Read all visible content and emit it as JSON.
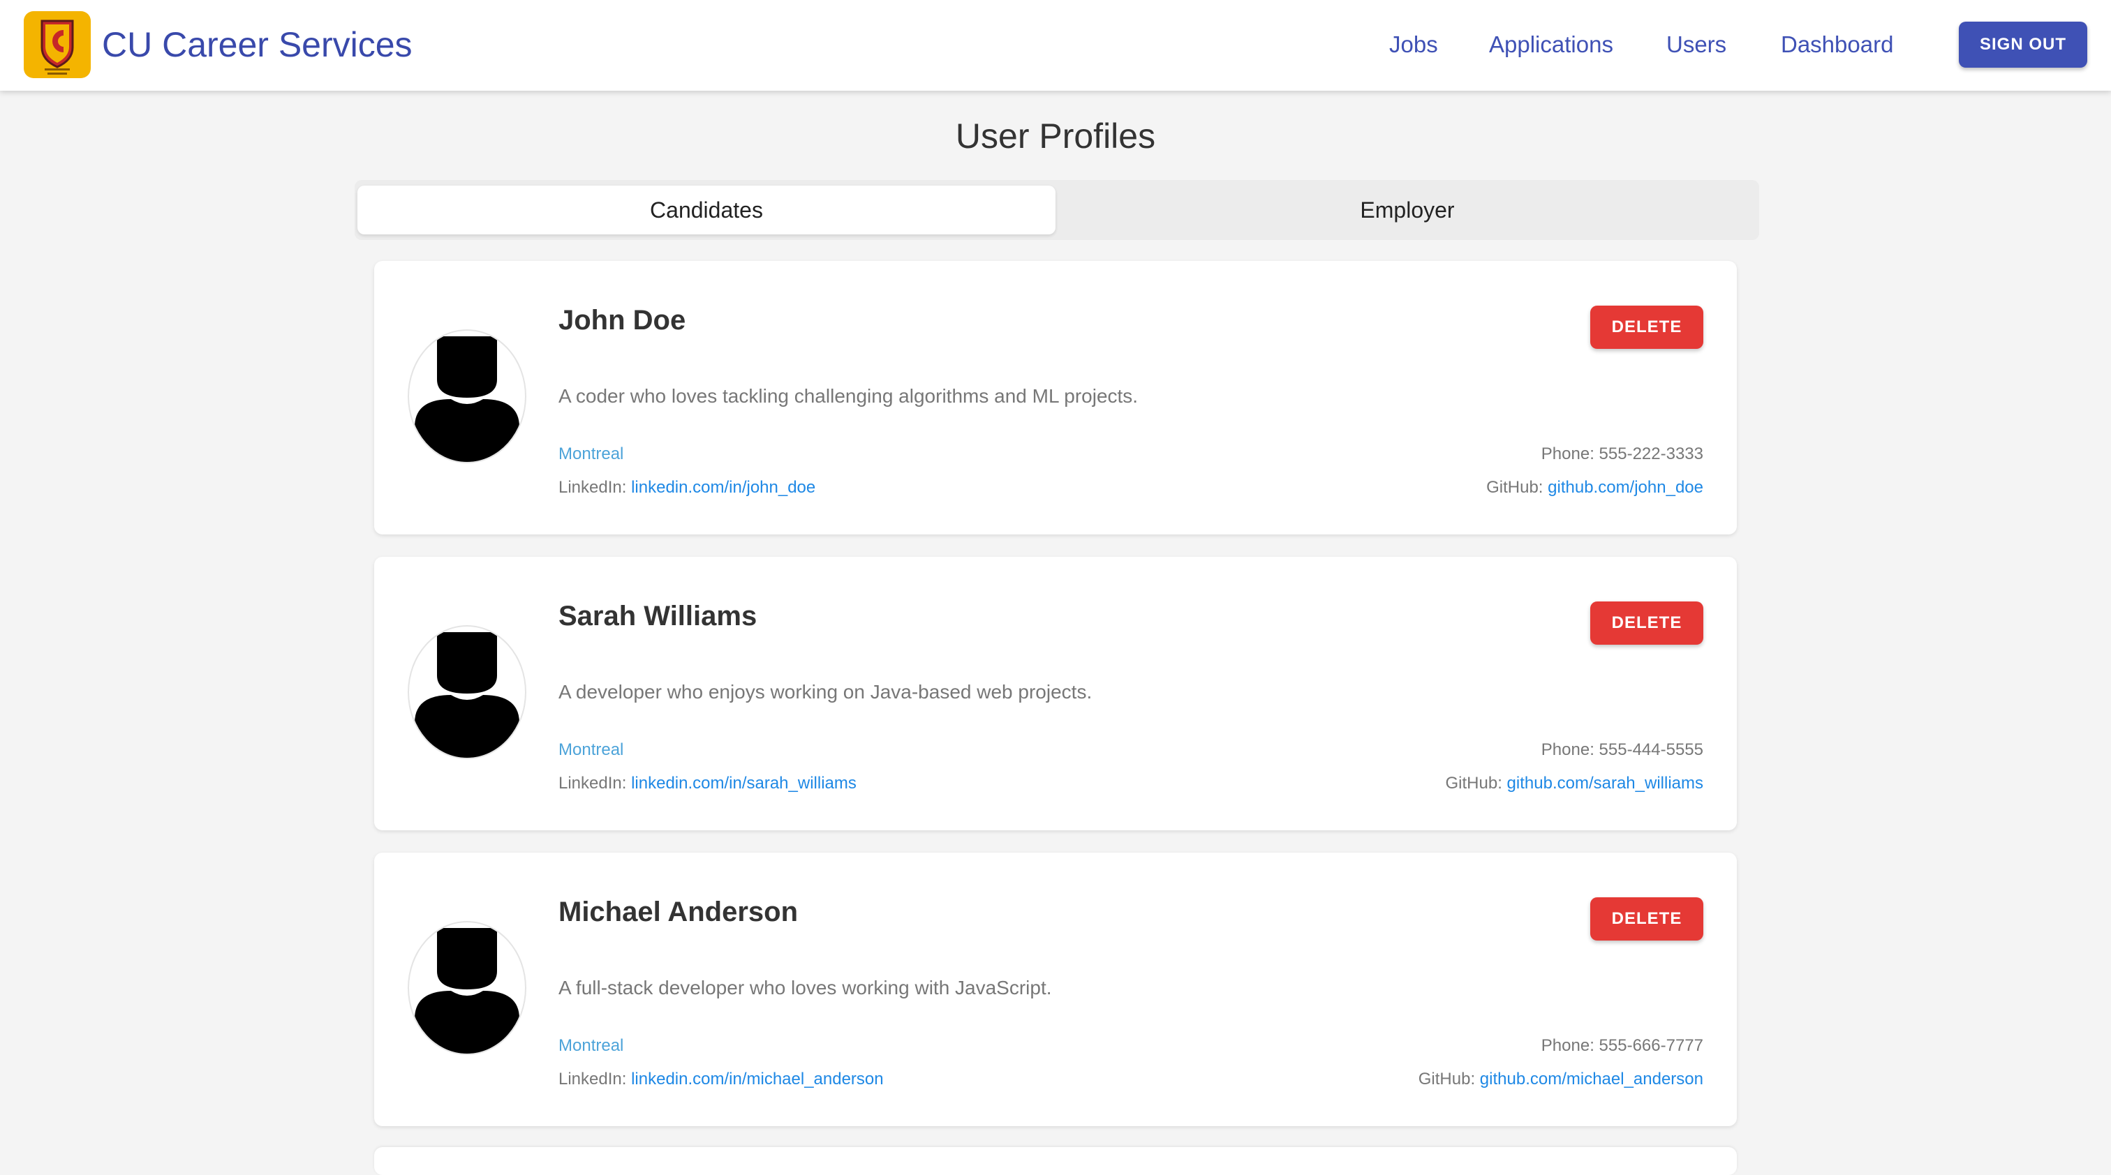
{
  "header": {
    "brand": "CU Career Services",
    "logo_icon": "career-center-shield-logo",
    "logo_color": "#f4b400",
    "nav": [
      "Jobs",
      "Applications",
      "Users",
      "Dashboard"
    ],
    "signout_label": "SIGN OUT"
  },
  "page": {
    "title": "User Profiles",
    "tabs": [
      {
        "label": "Candidates",
        "active": true
      },
      {
        "label": "Employer",
        "active": false
      }
    ]
  },
  "colors": {
    "primary": "#3f51b5",
    "danger": "#e53935",
    "link": "#1e88e5",
    "location": "#4ca3d9"
  },
  "profiles": [
    {
      "name": "John Doe",
      "bio": "A coder who loves tackling challenging algorithms and ML projects.",
      "location": "Montreal",
      "phone": "Phone: 555-222-3333",
      "linkedin_label": "LinkedIn:",
      "linkedin": "linkedin.com/in/john_doe",
      "github_label": "GitHub:",
      "github": "github.com/john_doe",
      "delete_label": "DELETE"
    },
    {
      "name": "Sarah Williams",
      "bio": "A developer who enjoys working on Java-based web projects.",
      "location": "Montreal",
      "phone": "Phone: 555-444-5555",
      "linkedin_label": "LinkedIn:",
      "linkedin": "linkedin.com/in/sarah_williams",
      "github_label": "GitHub:",
      "github": "github.com/sarah_williams",
      "delete_label": "DELETE"
    },
    {
      "name": "Michael Anderson",
      "bio": "A full-stack developer who loves working with JavaScript.",
      "location": "Montreal",
      "phone": "Phone: 555-666-7777",
      "linkedin_label": "LinkedIn:",
      "linkedin": "linkedin.com/in/michael_anderson",
      "github_label": "GitHub:",
      "github": "github.com/michael_anderson",
      "delete_label": "DELETE"
    }
  ]
}
